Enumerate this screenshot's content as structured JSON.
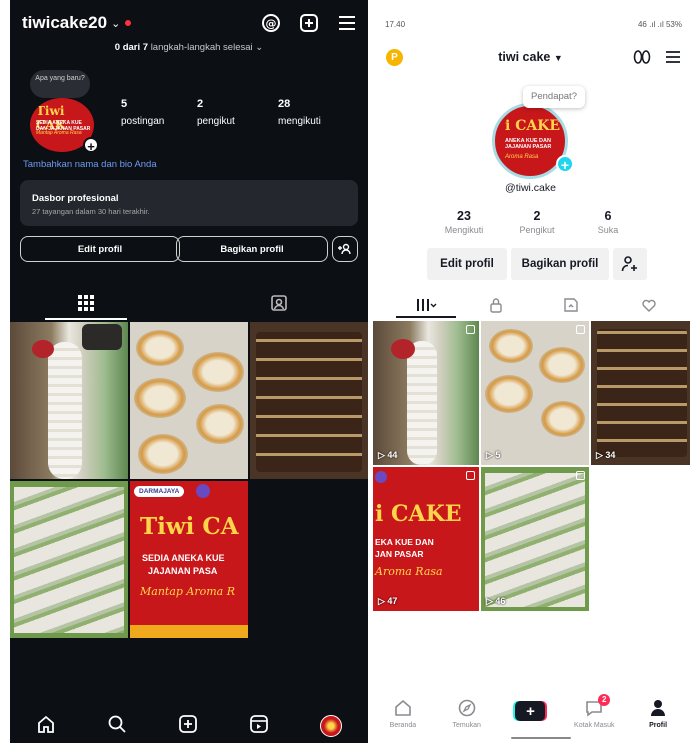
{
  "instagram": {
    "username": "tiwicake20",
    "steps_done": "0 dari 7",
    "steps_rest": "langkah-langkah selesai",
    "note_bubble": "Apa yang baru?",
    "avatar_text": {
      "title": "Tiwi CAK",
      "line": "SEDIA ANEKA KUE DAN JAJANAN PASAR",
      "script": "Mantap Aroma Rasa"
    },
    "stats": [
      {
        "value": "5",
        "label": "postingan"
      },
      {
        "value": "2",
        "label": "pengikut"
      },
      {
        "value": "28",
        "label": "mengikuti"
      }
    ],
    "bio_prompt": "Tambahkan nama dan bio Anda",
    "dashboard": {
      "title": "Dasbor profesional",
      "subtitle": "27 tayangan dalam 30 hari terakhir."
    },
    "buttons": {
      "edit": "Edit profil",
      "share": "Bagikan profil"
    },
    "post_banner": {
      "org": "DARMAJAYA",
      "title": "Tiwi CA",
      "line1": "SEDIA ANEKA KUE",
      "line2": "JAJANAN PASA",
      "script": "Mantap Aroma R"
    }
  },
  "tiktok": {
    "status_time": "17.40",
    "status_right": "46 .ıl .ıl 53%",
    "profile_initial": "P",
    "username": "tiwi cake",
    "note_bubble": "Pendapat?",
    "avatar_text": {
      "title": "i CAKE",
      "line": "ANEKA KUE DAN JAJANAN PASAR",
      "script": "Aroma Rasa"
    },
    "handle": "@tiwi.cake",
    "stats": [
      {
        "value": "23",
        "label": "Mengikuti"
      },
      {
        "value": "2",
        "label": "Pengikut"
      },
      {
        "value": "6",
        "label": "Suka"
      }
    ],
    "buttons": {
      "edit": "Edit profil",
      "share": "Bagikan profil"
    },
    "videos": [
      {
        "views": "44"
      },
      {
        "views": "5"
      },
      {
        "views": "34"
      },
      {
        "views": "47"
      },
      {
        "views": "46"
      }
    ],
    "banner": {
      "title": "i CAKE",
      "line1": "EKA KUE DAN",
      "line2": "JAN PASAR",
      "script": "Aroma Rasa"
    },
    "nav": [
      {
        "label": "Beranda"
      },
      {
        "label": "Temukan"
      },
      {
        "label": ""
      },
      {
        "label": "Kotak Masuk",
        "badge": "2"
      },
      {
        "label": "Profil"
      }
    ]
  }
}
